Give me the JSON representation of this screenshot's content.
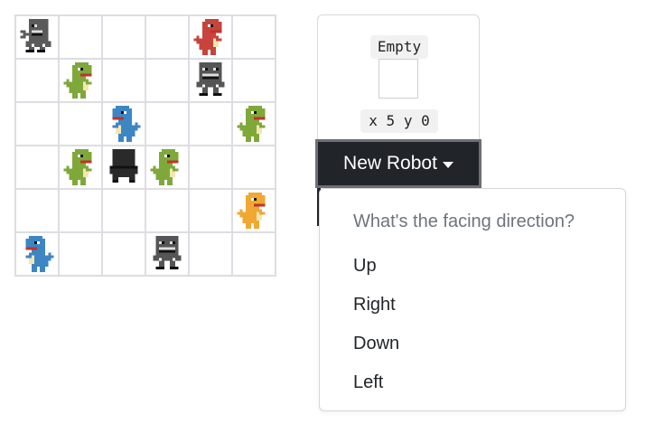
{
  "board": {
    "rows": 6,
    "cols": 6,
    "cells": [
      [
        {
          "sprite": "gray-robot"
        },
        null,
        null,
        null,
        {
          "sprite": "red-dino"
        },
        null
      ],
      [
        null,
        {
          "sprite": "green-dino"
        },
        null,
        null,
        {
          "sprite": "gray-robot-front"
        },
        null
      ],
      [
        null,
        null,
        {
          "sprite": "blue-dino"
        },
        null,
        null,
        {
          "sprite": "green-dino"
        }
      ],
      [
        null,
        {
          "sprite": "green-dino"
        },
        {
          "sprite": "black-robot"
        },
        {
          "sprite": "green-dino"
        },
        null,
        null
      ],
      [
        null,
        null,
        null,
        null,
        null,
        {
          "sprite": "orange-dino"
        }
      ],
      [
        {
          "sprite": "blue-dino"
        },
        null,
        null,
        {
          "sprite": "gray-robot-front"
        },
        null,
        null
      ]
    ],
    "colors": {
      "gray-robot": "#5a5a5a",
      "gray-robot-front": "#555555",
      "black-robot": "#2a2a2a",
      "red-dino": "#c8433c",
      "green-dino": "#7fa83a",
      "blue-dino": "#3d86c4",
      "orange-dino": "#f0a832"
    }
  },
  "panel": {
    "status_label": "Empty",
    "coords_label": "x 5 y 0",
    "new_robot_label": "New Robot"
  },
  "dropdown": {
    "header": "What's the facing direction?",
    "items": [
      "Up",
      "Right",
      "Down",
      "Left"
    ]
  }
}
